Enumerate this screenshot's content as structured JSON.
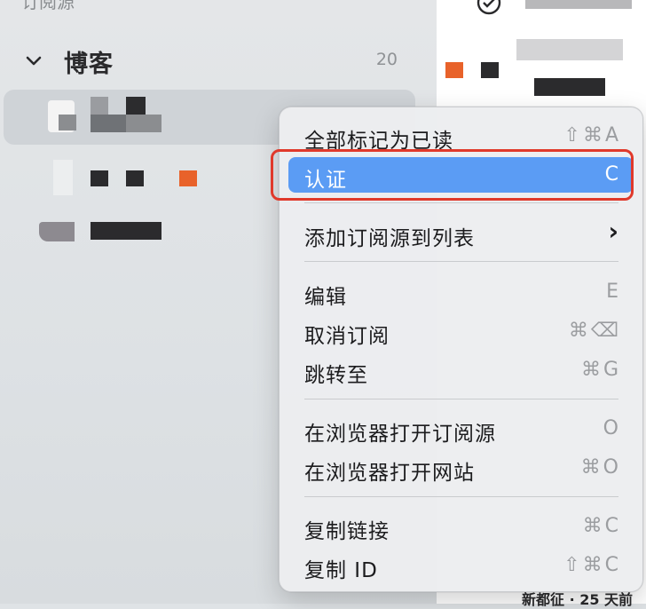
{
  "sidebar": {
    "section_title": "订阅源",
    "group": {
      "label": "博客",
      "count": "20"
    }
  },
  "menu": {
    "items": [
      {
        "label": "全部标记为已读",
        "shortcut": "⇧⌘A"
      },
      {
        "label": "认证",
        "shortcut": "C"
      },
      {
        "label": "添加订阅源到列表",
        "shortcut": "›"
      },
      {
        "label": "编辑",
        "shortcut": "E"
      },
      {
        "label": "取消订阅",
        "shortcut": "⌘⌫"
      },
      {
        "label": "跳转至",
        "shortcut": "⌘G"
      },
      {
        "label": "在浏览器打开订阅源",
        "shortcut": "O"
      },
      {
        "label": "在浏览器打开网站",
        "shortcut": "⌘O"
      },
      {
        "label": "复制链接",
        "shortcut": "⌘C"
      },
      {
        "label": "复制 ID",
        "shortcut": "⇧⌘C"
      }
    ]
  },
  "content": {
    "footer_text": "新都征 · 25 天前"
  },
  "colors": {
    "accent": "#5b9cf4",
    "highlight_border": "#e0392b",
    "orange": "#e8622a"
  }
}
